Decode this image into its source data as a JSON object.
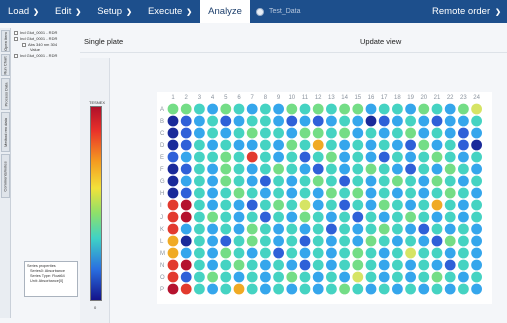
{
  "nav": {
    "items": [
      {
        "label": "Load",
        "chev": "❯"
      },
      {
        "label": "Edit",
        "chev": "❯"
      },
      {
        "label": "Setup",
        "chev": "❯"
      },
      {
        "label": "Execute",
        "chev": "❯"
      },
      {
        "label": "Analyze",
        "chev": ""
      }
    ],
    "data_label": "Test_Data",
    "remote_label": "Remote order",
    "remote_chev": "❯"
  },
  "side_tabs": [
    "Open Item",
    "Run Chart",
    "Process Data",
    "Method rev data",
    "Comments/notes"
  ],
  "tree": {
    "rows": [
      "Ind Glut_0001 - RDR",
      "Ind Glut_0001 - RDR",
      "Abs 340 nm 304",
      "Value",
      "Ind Glut_0001 - RDR"
    ]
  },
  "properties": {
    "rows": [
      "Series properties",
      "Series0: Absorbance",
      "Series Type: Float64",
      "Unit: Absorbance[0]"
    ]
  },
  "main": {
    "title": "Single plate",
    "update_view": "Update view"
  },
  "colorbar": {
    "max": "TESNEX",
    "min": "0"
  },
  "plate": {
    "columns": [
      "1",
      "2",
      "3",
      "4",
      "5",
      "6",
      "7",
      "8",
      "9",
      "10",
      "11",
      "12",
      "13",
      "14",
      "15",
      "16",
      "17",
      "18",
      "19",
      "20",
      "21",
      "22",
      "23",
      "24"
    ],
    "rows": [
      "A",
      "B",
      "C",
      "D",
      "E",
      "F",
      "G",
      "H",
      "I",
      "J",
      "K",
      "L",
      "M",
      "N",
      "O",
      "P"
    ],
    "palette": {
      "d": "#1a2a9a",
      "b": "#2f60d8",
      "s": "#35a6ec",
      "c": "#45d3c2",
      "g": "#74dd86",
      "y": "#d6e464",
      "o": "#f0aa24",
      "r": "#e23a2e",
      "m": "#b5122e"
    },
    "wells": [
      "ggcsgcscsgcgcggsccsgcsgy",
      "dbscbsccsbsbscsdbscsbssc",
      "dbscscgccsggcgscscgscsbs",
      "dbcscsscsgcocscscsbgscbd",
      "bsccgcrcscbcgscsbcscgcsc",
      "dbcsgcscgcsbcscgcsbcsgcs",
      "dscsgcsbcscgcbcscgcsgcsc",
      "dbcscgcscscsgcgscscscgcs",
      "rmcscsbcgcyscbcsgcscocsc",
      "rmcgcscbcsgcscbcscgcscsc",
      "rscscsgcscscbcscgcsbcscs",
      "odcsbcgcscbcscsgcscsbgcs",
      "oscsgcscbcscscgcscyccscs",
      "rmcscgcscsbcscgcscscsbcs",
      "rbcgcscscgcscsycscscgcsc",
      "mrcscocscscscgcscscscscs"
    ]
  }
}
